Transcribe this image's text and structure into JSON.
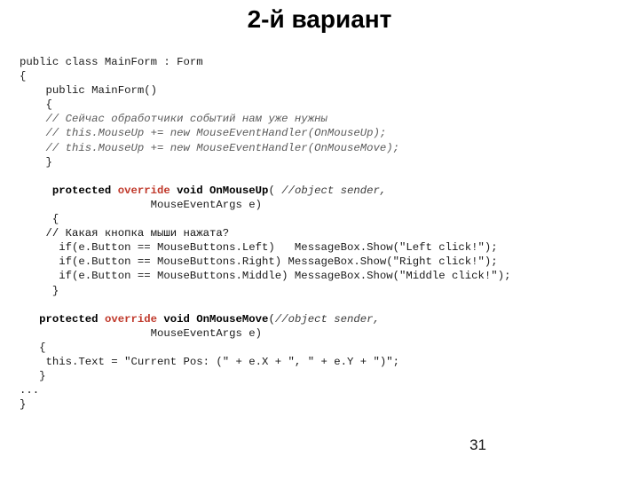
{
  "slide": {
    "title": "2-й вариант",
    "page_number": "31",
    "background_color": "#ffffff"
  },
  "colors": {
    "text": "#1a1a1a",
    "keyword_override": "#c0392b",
    "comment_gray": "#5a5a5a",
    "comment_black": "#111111",
    "title": "#000000"
  },
  "code": {
    "language": "csharp",
    "lines": [
      {
        "id": "l1",
        "text": "public class MainForm : Form",
        "style": "plain"
      },
      {
        "id": "l2",
        "text": "{",
        "style": "plain"
      },
      {
        "id": "l3",
        "text": "    public MainForm()",
        "style": "plain"
      },
      {
        "id": "l4",
        "text": "    {",
        "style": "plain"
      },
      {
        "id": "l5",
        "text": "    // Сейчас обработчики событий нам уже нужны",
        "style": "comment"
      },
      {
        "id": "l6",
        "text": "    // this.MouseUp += new MouseEventHandler(OnMouseUp);",
        "style": "comment"
      },
      {
        "id": "l7",
        "text": "    // this.MouseUp += new MouseEventHandler(OnMouseMove);",
        "style": "comment"
      },
      {
        "id": "l8",
        "text": "    }",
        "style": "plain"
      },
      {
        "id": "l9",
        "text": "",
        "style": "blank"
      },
      {
        "id": "l10",
        "segments": [
          {
            "text": "     protected ",
            "style": "bold"
          },
          {
            "text": "override",
            "style": "keyword"
          },
          {
            "text": " void OnMouseUp",
            "style": "bold"
          },
          {
            "text": "( ",
            "style": "plain"
          },
          {
            "text": "//object sender,",
            "style": "sig"
          }
        ]
      },
      {
        "id": "l11",
        "text": "                    MouseEventArgs e)",
        "style": "plain"
      },
      {
        "id": "l12",
        "text": "     {",
        "style": "plain"
      },
      {
        "id": "l13",
        "text": "    // Какая кнопка мыши нажата?",
        "style": "comment-plain"
      },
      {
        "id": "l14",
        "text": "      if(e.Button == MouseButtons.Left)   MessageBox.Show(\"Left click!\");",
        "style": "plain"
      },
      {
        "id": "l15",
        "text": "      if(e.Button == MouseButtons.Right) MessageBox.Show(\"Right click!\");",
        "style": "plain"
      },
      {
        "id": "l16",
        "text": "      if(e.Button == MouseButtons.Middle) MessageBox.Show(\"Middle click!\");",
        "style": "plain"
      },
      {
        "id": "l17",
        "text": "     }",
        "style": "plain"
      },
      {
        "id": "l18",
        "text": "",
        "style": "blank"
      },
      {
        "id": "l19",
        "segments": [
          {
            "text": "   protected ",
            "style": "bold"
          },
          {
            "text": "override",
            "style": "keyword"
          },
          {
            "text": " void OnMouseMove",
            "style": "bold"
          },
          {
            "text": "(",
            "style": "plain"
          },
          {
            "text": "//object sender,",
            "style": "sig"
          }
        ]
      },
      {
        "id": "l20",
        "text": "                    MouseEventArgs e)",
        "style": "plain"
      },
      {
        "id": "l21",
        "text": "   {",
        "style": "plain"
      },
      {
        "id": "l22",
        "text": "    this.Text = \"Current Pos: (\" + e.X + \", \" + e.Y + \")\";",
        "style": "plain"
      },
      {
        "id": "l23",
        "text": "   }",
        "style": "plain"
      },
      {
        "id": "l24",
        "text": "...",
        "style": "plain"
      },
      {
        "id": "l25",
        "text": "}",
        "style": "plain"
      }
    ]
  }
}
